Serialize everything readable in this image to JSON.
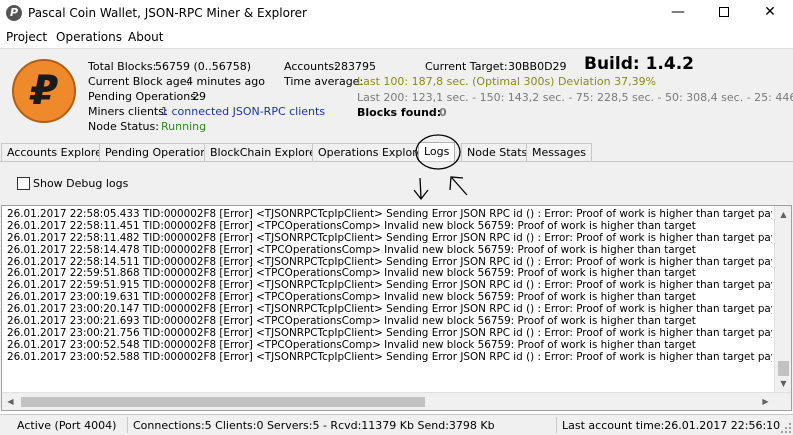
{
  "window": {
    "title": "Pascal Coin Wallet, JSON-RPC Miner & Explorer",
    "minimize_glyph": "—",
    "close_glyph": "✕"
  },
  "menu": {
    "items": [
      "Project",
      "Operations",
      "About"
    ]
  },
  "info": {
    "total_blocks_label": "Total Blocks:",
    "total_blocks_value": "56759 (0..56758)",
    "block_age_label": "Current Block age:",
    "block_age_value": "4 minutes ago",
    "pending_label": "Pending Operations:",
    "pending_value": "29",
    "miners_label": "Miners clients:",
    "miners_value": "1 connected JSON-RPC clients",
    "node_status_label": "Node Status:",
    "node_status_value": "Running",
    "accounts_label": "Accounts:",
    "accounts_value": "283795",
    "target_label": "Current Target:",
    "target_value": "30BB0D29",
    "build": "Build: 1.4.2",
    "time_avg_label": "Time average:",
    "time_avg_value": "Last 100: 187,8 sec. (Optimal 300s) Deviation 37,39%",
    "time_avg_history": "Last 200: 123,1 sec. - 150: 143,2 sec. - 75: 228,5 sec. - 50: 308,4 sec. - 25: 446,5 sec.",
    "blocks_found_label": "Blocks found:",
    "blocks_found_value": "0"
  },
  "tabs": [
    {
      "label": "Accounts Explorer"
    },
    {
      "label": "Pending Operations"
    },
    {
      "label": "BlockChain Explorer"
    },
    {
      "label": "Operations Explorer"
    },
    {
      "label": "Logs"
    },
    {
      "label": "Node Stats"
    },
    {
      "label": "Messages"
    }
  ],
  "logs_tab": {
    "show_debug_label": "Show Debug logs",
    "show_debug_checked": false,
    "lines": [
      "26.01.2017 22:58:05.433 TID:000002F8 [Error] <TJSONRPCTcpIpClient> Sending Error JSON RPC id () : Error: Proof of work is higher than target payload:Sl",
      "26.01.2017 22:58:11.451 TID:000002F8 [Error] <TPCOperationsComp> Invalid new block 56759: Proof of work is higher than target",
      "26.01.2017 22:58:11.482 TID:000002F8 [Error] <TJSONRPCTcpIpClient> Sending Error JSON RPC id () : Error: Proof of work is higher than target payload:Sl",
      "26.01.2017 22:58:14.478 TID:000002F8 [Error] <TPCOperationsComp> Invalid new block 56759: Proof of work is higher than target",
      "26.01.2017 22:58:14.511 TID:000002F8 [Error] <TJSONRPCTcpIpClient> Sending Error JSON RPC id () : Error: Proof of work is higher than target payload:Sl",
      "26.01.2017 22:59:51.868 TID:000002F8 [Error] <TPCOperationsComp> Invalid new block 56759: Proof of work is higher than target",
      "26.01.2017 22:59:51.915 TID:000002F8 [Error] <TJSONRPCTcpIpClient> Sending Error JSON RPC id () : Error: Proof of work is higher than target payload:Sl",
      "26.01.2017 23:00:19.631 TID:000002F8 [Error] <TPCOperationsComp> Invalid new block 56759: Proof of work is higher than target",
      "26.01.2017 23:00:20.147 TID:000002F8 [Error] <TJSONRPCTcpIpClient> Sending Error JSON RPC id () : Error: Proof of work is higher than target payload:Sl",
      "26.01.2017 23:00:21.693 TID:000002F8 [Error] <TPCOperationsComp> Invalid new block 56759: Proof of work is higher than target",
      "26.01.2017 23:00:21.756 TID:000002F8 [Error] <TJSONRPCTcpIpClient> Sending Error JSON RPC id () : Error: Proof of work is higher than target payload:Sl",
      "26.01.2017 23:00:52.548 TID:000002F8 [Error] <TPCOperationsComp> Invalid new block 56759: Proof of work is higher than target",
      "26.01.2017 23:00:52.588 TID:000002F8 [Error] <TJSONRPCTcpIpClient> Sending Error JSON RPC id () : Error: Proof of work is higher than target payload:Sl"
    ]
  },
  "status": {
    "active": "Active (Port 4004)",
    "connections": "Connections:5 Clients:0 Servers:5 - Rcvd:11379 Kb Send:3798 Kb",
    "last_account_time": "Last account time:26.01.2017 22:56:10"
  },
  "colors": {
    "logo_fill": "#ef8a2c",
    "link": "#1a31b8",
    "running": "#2e8a1f",
    "time_avg": "#8a8a1a",
    "history": "#7a7a7a"
  }
}
